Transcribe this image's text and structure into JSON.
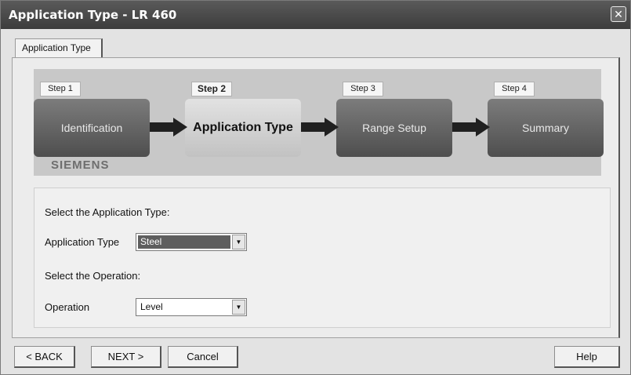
{
  "window": {
    "title": "Application Type - LR 460",
    "close_glyph": "✕"
  },
  "tabs": [
    {
      "label": "Application Type"
    }
  ],
  "wizard": {
    "brand": "SIEMENS",
    "steps": [
      {
        "number_label": "Step 1",
        "name": "Identification"
      },
      {
        "number_label": "Step 2",
        "name": "Application Type"
      },
      {
        "number_label": "Step 3",
        "name": "Range Setup"
      },
      {
        "number_label": "Step 4",
        "name": "Summary"
      }
    ],
    "active_step": 2
  },
  "form": {
    "application_prompt": "Select the Application Type:",
    "application_label": "Application Type",
    "application_value": "Steel",
    "operation_prompt": "Select the Operation:",
    "operation_label": "Operation",
    "operation_value": "Level",
    "dropdown_glyph": "▼"
  },
  "buttons": {
    "back": "< BACK",
    "next": "NEXT >",
    "cancel": "Cancel",
    "help": "Help"
  }
}
